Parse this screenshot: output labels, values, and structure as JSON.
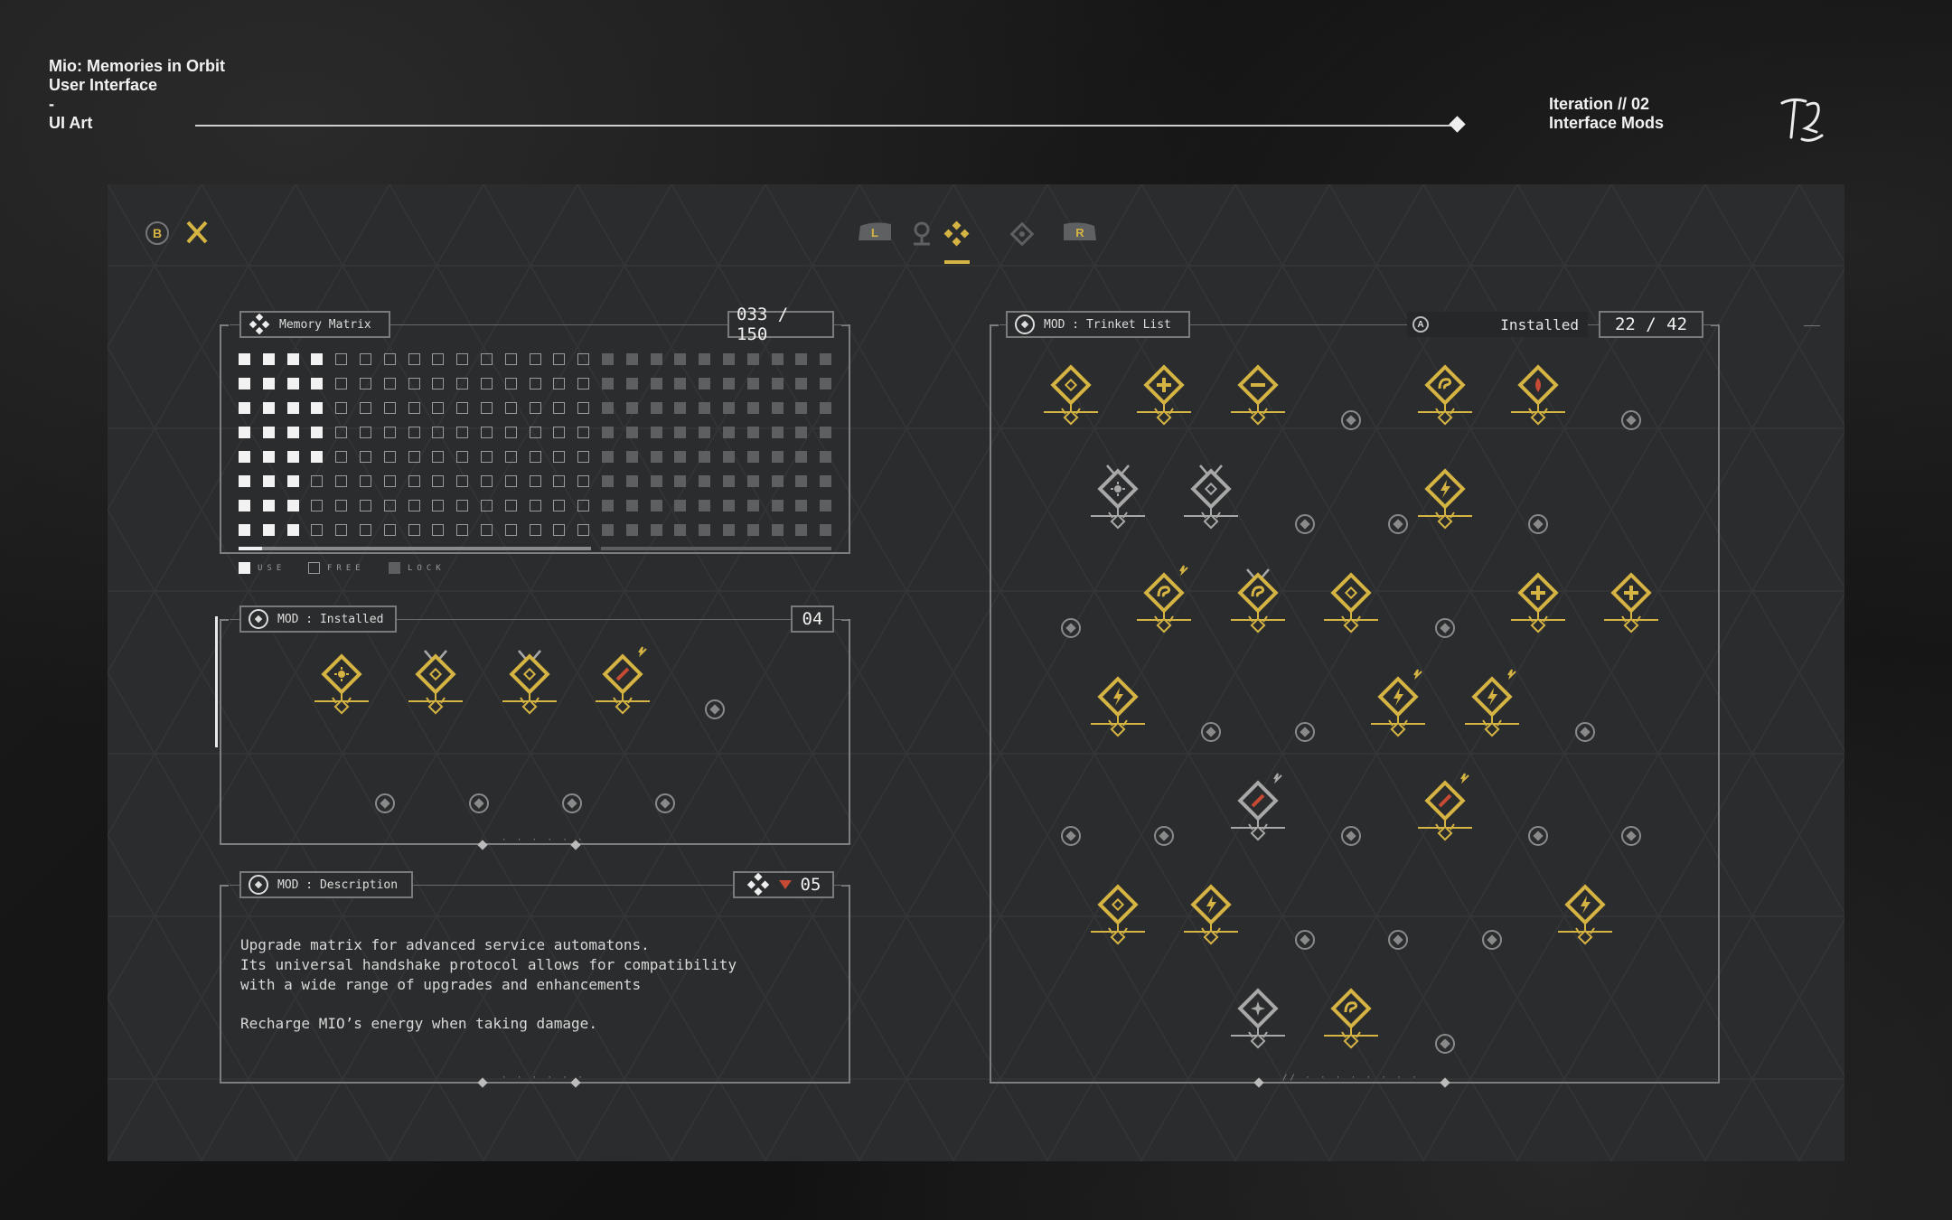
{
  "header": {
    "left_lines": [
      "Mio: Memories in Orbit",
      "User Interface",
      "-",
      "UI Art"
    ],
    "right_lines": [
      "Iteration // 02",
      "Interface Mods"
    ]
  },
  "topbar": {
    "back_button": "B",
    "tabs": [
      {
        "name": "shoulder-left",
        "label": "L",
        "active": false
      },
      {
        "name": "map",
        "label": "",
        "active": false
      },
      {
        "name": "mods",
        "label": "",
        "active": true
      },
      {
        "name": "memories",
        "label": "",
        "active": false
      },
      {
        "name": "shoulder-right",
        "label": "R",
        "active": false
      }
    ]
  },
  "memory_matrix": {
    "title": "Memory Matrix",
    "count": "033 / 150",
    "legend": [
      "USE",
      "FREE",
      "LOCK"
    ]
  },
  "installed": {
    "title": "MOD : Installed",
    "count": "04",
    "footer": "· · · · · ·"
  },
  "description": {
    "title": "MOD : Description",
    "count": "05",
    "lines": [
      "Upgrade matrix for advanced service automatons.",
      "Its universal handshake protocol allows for compatibility",
      "with a wide range of upgrades and enhancements",
      "",
      "Recharge MIO’s energy when taking damage."
    ],
    "footer": "· · · · · ·"
  },
  "trinket_list": {
    "title": "MOD : Trinket List",
    "button": "A",
    "filter": "Installed",
    "count": "22 / 42",
    "footer": "// · · · · · · · ·"
  },
  "colors": {
    "gold": "#d6b444",
    "accent_red": "#c64a34",
    "panel_bg": "#2b2c2d"
  }
}
